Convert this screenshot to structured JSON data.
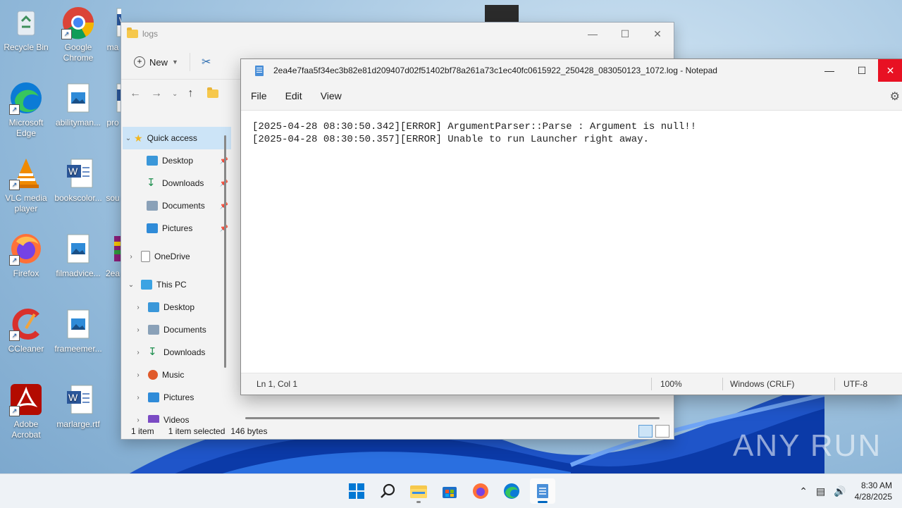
{
  "desktop": {
    "icons": [
      {
        "label": "Recycle Bin",
        "icon": "recycle-bin-icon"
      },
      {
        "label": "Google Chrome",
        "icon": "chrome-icon"
      },
      {
        "label": "ma",
        "icon": "word-doc-icon"
      },
      {
        "label": "Microsoft Edge",
        "icon": "edge-icon"
      },
      {
        "label": "abilityman...",
        "icon": "image-file-icon"
      },
      {
        "label": "pro",
        "icon": "word-doc-icon"
      },
      {
        "label": "VLC media player",
        "icon": "vlc-icon"
      },
      {
        "label": "bookscolor...",
        "icon": "word-doc-icon"
      },
      {
        "label": "sou",
        "icon": "file-icon"
      },
      {
        "label": "Firefox",
        "icon": "firefox-icon"
      },
      {
        "label": "filmadvice...",
        "icon": "image-file-icon"
      },
      {
        "label": "2ea",
        "icon": "archive-icon"
      },
      {
        "label": "CCleaner",
        "icon": "ccleaner-icon"
      },
      {
        "label": "frameemer...",
        "icon": "image-file-icon"
      },
      {
        "label": "Adobe Acrobat",
        "icon": "acrobat-icon"
      },
      {
        "label": "marlarge.rtf",
        "icon": "word-doc-icon"
      }
    ],
    "watermark": "ANY RUN"
  },
  "explorer": {
    "title": "logs",
    "toolbar": {
      "new_label": "New"
    },
    "sidebar": {
      "quick_access": "Quick access",
      "quick_items": [
        {
          "label": "Desktop"
        },
        {
          "label": "Downloads"
        },
        {
          "label": "Documents"
        },
        {
          "label": "Pictures"
        }
      ],
      "onedrive": "OneDrive",
      "this_pc": "This PC",
      "pc_items": [
        {
          "label": "Desktop"
        },
        {
          "label": "Documents"
        },
        {
          "label": "Downloads"
        },
        {
          "label": "Music"
        },
        {
          "label": "Pictures"
        },
        {
          "label": "Videos"
        }
      ]
    },
    "status": {
      "items": "1 item",
      "selected": "1 item selected",
      "size": "146 bytes"
    }
  },
  "notepad": {
    "title": "2ea4e7faa5f34ec3b82e81d209407d02f51402bf78a261a73c1ec40fc0615922_250428_083050123_1072.log - Notepad",
    "menu": {
      "file": "File",
      "edit": "Edit",
      "view": "View"
    },
    "content": "[2025-04-28 08:30:50.342][ERROR] ArgumentParser::Parse : Argument is null!!\n[2025-04-28 08:30:50.357][ERROR] Unable to run Launcher right away.",
    "status": {
      "position": "Ln 1, Col 1",
      "zoom": "100%",
      "line_ending": "Windows (CRLF)",
      "encoding": "UTF-8"
    }
  },
  "taskbar": {
    "time": "8:30 AM",
    "date": "4/28/2025",
    "apps": [
      "start-icon",
      "search-icon",
      "file-explorer-icon",
      "store-icon",
      "firefox-icon",
      "edge-icon",
      "notepad-icon"
    ]
  },
  "colors": {
    "accent": "#0067c0",
    "close_red": "#e81123",
    "selection": "#cce4f7"
  }
}
